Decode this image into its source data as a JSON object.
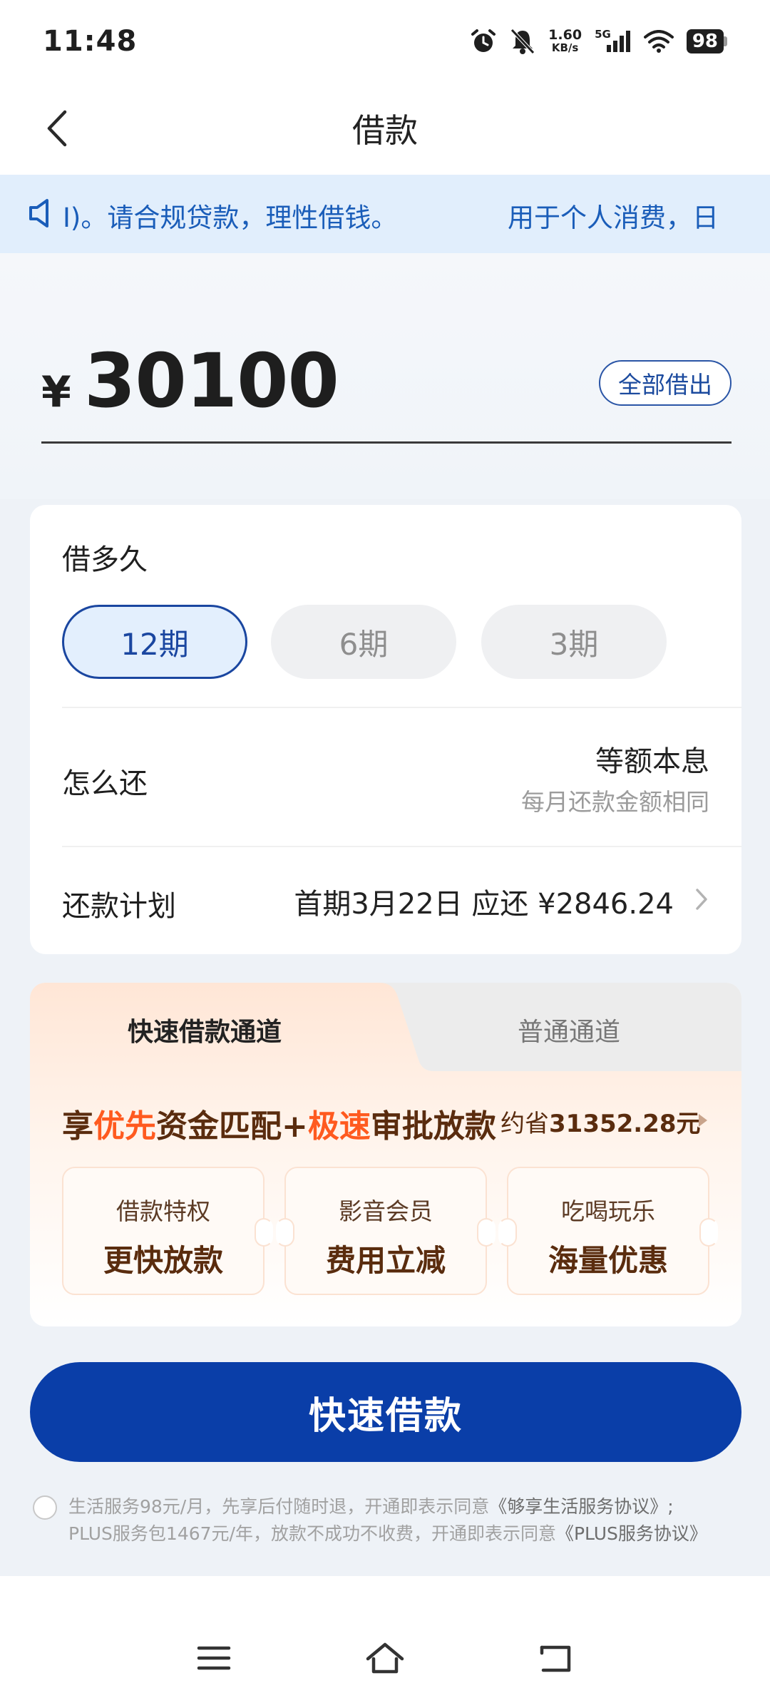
{
  "status_bar": {
    "time": "11:48",
    "net_speed_value": "1.60",
    "net_speed_unit": "KB/s",
    "signal_label": "5G",
    "battery": "98",
    "icons": [
      "alarm-icon",
      "bell-muted-icon",
      "signal-icon",
      "wifi-icon",
      "battery-icon"
    ]
  },
  "header": {
    "title": "借款",
    "back_icon": "chevron-left-icon"
  },
  "notice": {
    "icon": "speaker-icon",
    "text_1": "I)。请合规贷款，理性借钱。",
    "text_2": "用于个人消费，日"
  },
  "amount": {
    "currency": "¥",
    "value": "30100",
    "all_button": "全部借出"
  },
  "loan": {
    "howlong_label": "借多久",
    "terms": [
      {
        "label": "12期",
        "selected": true
      },
      {
        "label": "6期",
        "selected": false
      },
      {
        "label": "3期",
        "selected": false
      }
    ],
    "how_label": "怎么还",
    "repay_type": "等额本息",
    "repay_sub": "每月还款金额相同",
    "plan_label": "还款计划",
    "plan_value": "首期3月22日 应还 ¥2846.24"
  },
  "channel": {
    "tab_fast": "快速借款通道",
    "tab_normal": "普通通道",
    "promo_1": "享",
    "promo_2": "优先",
    "promo_3": "资金匹配+",
    "promo_4": "极速",
    "promo_5": "审批放款",
    "savings_prefix": "约省",
    "savings_value": "31352.28元",
    "benefits": [
      {
        "title": "借款特权",
        "value": "更快放款"
      },
      {
        "title": "影音会员",
        "value": "费用立减"
      },
      {
        "title": "吃喝玩乐",
        "value": "海量优惠"
      }
    ]
  },
  "cta": {
    "label": "快速借款"
  },
  "agreement": {
    "line1_text": "生活服务98元/月，先享后付随时退，开通即表示同意",
    "line1_link": "《够享生活服务协议》;",
    "line2_text": "PLUS服务包1467元/年，放款不成功不收费，开通即表示同意",
    "line2_link": "《PLUS服务协议》"
  },
  "nav": {
    "icons": [
      "menu-icon",
      "home-icon",
      "back-icon"
    ]
  },
  "colors": {
    "primary": "#0a3ea8",
    "accent_orange": "#ff5a1f",
    "notice_bg": "#e1eefc",
    "notice_text": "#1a5db9"
  }
}
